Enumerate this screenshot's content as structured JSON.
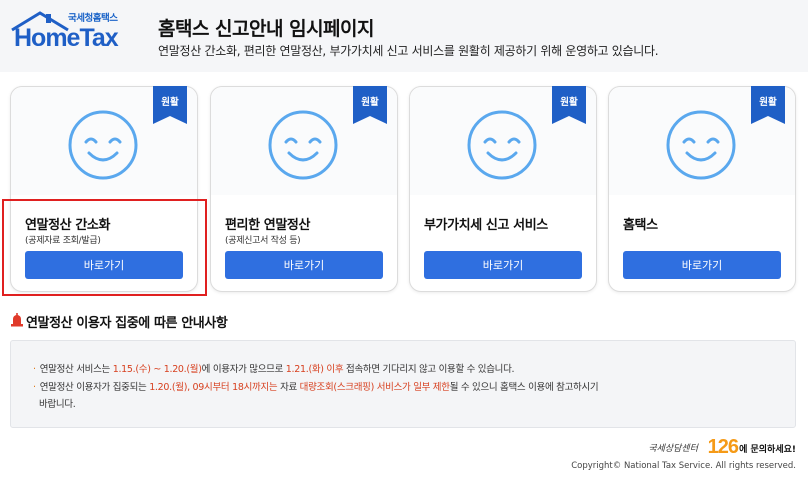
{
  "header": {
    "logo_top": "국세청홈택스",
    "logo_main": "HomeTax",
    "title": "홈택스 신고안내 임시페이지",
    "description": "연말정산 간소화, 편리한 연말정산, 부가가치세 신고 서비스를 원활히 제공하기 위해 운영하고 있습니다."
  },
  "cards": [
    {
      "badge": "원활",
      "title": "연말정산 간소화",
      "subtitle": "(공제자료 조회/발급)",
      "button": "바로가기"
    },
    {
      "badge": "원활",
      "title": "편리한 연말정산",
      "subtitle": "(공제신고서 작성 등)",
      "button": "바로가기"
    },
    {
      "badge": "원활",
      "title": "부가가치세 신고 서비스",
      "subtitle": "",
      "button": "바로가기"
    },
    {
      "badge": "원활",
      "title": "홈택스",
      "subtitle": "",
      "button": "바로가기"
    }
  ],
  "notice": {
    "title": "연말정산 이용자 집중에 따른 안내사항",
    "line1_a": "연말정산 서비스는 ",
    "line1_b": "1.15.(수) ~ 1.20.(월)",
    "line1_c": "에 이용자가 많으므로 ",
    "line1_d": "1.21.(화) 이후",
    "line1_e": " 접속하면 기다리지 않고 이용할 수 있습니다.",
    "line2_a": "연말정산 이용자가 집중되는 ",
    "line2_b": "1.20.(월), 09시부터 18시까지는",
    "line2_c": " 자료 ",
    "line2_d": "대량조회(스크래핑) 서비스가 일부 제한",
    "line2_e": "될 수 있으니 홈택스 이용에 참고하시기",
    "line3": "바랍니다."
  },
  "footer": {
    "callcenter_pre": "국세상담센터",
    "callcenter_num": "126",
    "callcenter_post": "에 문의하세요!",
    "copyright": "Copyright© National Tax Service. All rights reserved."
  },
  "colors": {
    "accent": "#2f6fe0",
    "badge": "#1f5fc6",
    "highlight": "#e02020",
    "date_highlight": "#d7401f",
    "smile": "#5aa8ee"
  }
}
